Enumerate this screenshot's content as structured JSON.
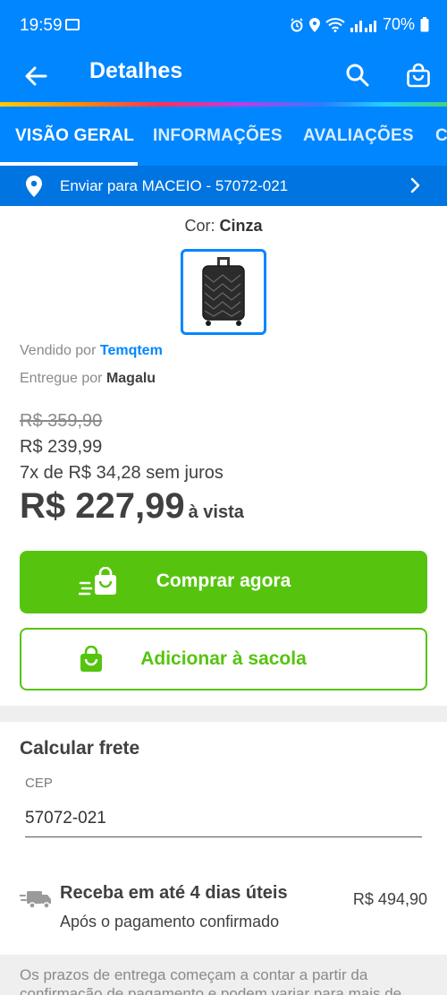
{
  "status_bar": {
    "time": "19:59",
    "battery": "70%"
  },
  "app_bar": {
    "title": "Detalhes",
    "icons": [
      "arrow-back-icon",
      "search-icon",
      "shopping-bag-icon"
    ]
  },
  "tabs": [
    {
      "label": "VISÃO GERAL",
      "active": true
    },
    {
      "label": "INFORMAÇÕES",
      "active": false
    },
    {
      "label": "AVALIAÇÕES",
      "active": false
    },
    {
      "label": "C",
      "active": false
    }
  ],
  "shipping_bar": {
    "text": "Enviar para MACEIO - 57072-021"
  },
  "product": {
    "color_label": "Cor: ",
    "color_value": "Cinza",
    "sold_by_label": "Vendido por ",
    "seller": "Temqtem",
    "delivered_by_label": "Entregue por ",
    "carrier": "Magalu",
    "old_price": "R$ 359,90",
    "price": "R$ 239,99",
    "installments": "7x de R$ 34,28 sem juros",
    "cash_price": "R$ 227,99",
    "cash_suffix": "à vista"
  },
  "actions": {
    "buy_now": "Comprar agora",
    "add_to_bag": "Adicionar à sacola"
  },
  "freight": {
    "title": "Calcular frete",
    "cep_label": "CEP",
    "cep_value": "57072-021",
    "delivery_title": "Receba em até 4 dias úteis",
    "delivery_subtitle": "Após o pagamento confirmado",
    "delivery_price": "R$ 494,90",
    "note": "Os prazos de entrega começam a contar a partir da confirmação de pagamento e podem variar para mais de"
  },
  "colors": {
    "primary_blue": "#0086ff",
    "shipping_bar_blue": "#0074e0",
    "green": "#56c40e"
  }
}
